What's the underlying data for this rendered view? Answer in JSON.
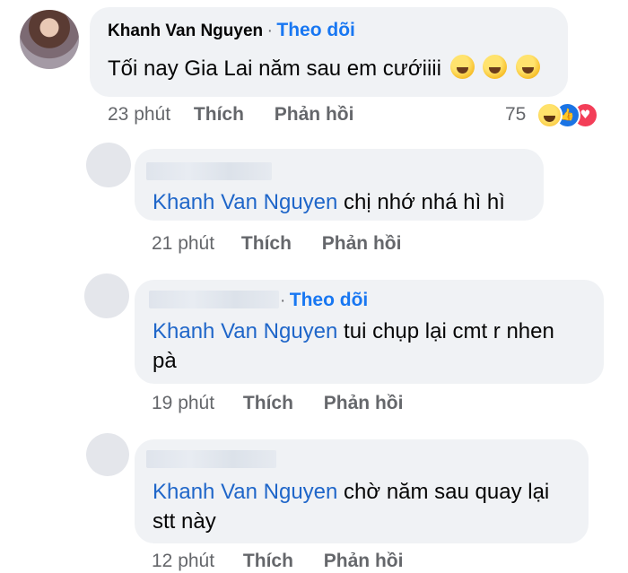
{
  "top_comment": {
    "author": "Khanh Van Nguyen",
    "separator": "·",
    "follow_label": "Theo dõi",
    "text": "Tối nay Gia Lai năm sau em cướiiii",
    "emojis": [
      "rolling-on-floor-laughing",
      "rolling-on-floor-laughing",
      "rolling-on-floor-laughing"
    ],
    "time": "23 phút",
    "like_label": "Thích",
    "reply_label": "Phản hồi",
    "reaction_count": "75",
    "reactions": [
      "haha",
      "like",
      "love"
    ]
  },
  "replies": [
    {
      "author": "",
      "mention": "Khanh Van Nguyen",
      "text": " chị nhớ nhá hì hì",
      "time": "21 phút",
      "like_label": "Thích",
      "reply_label": "Phản hồi"
    },
    {
      "author": "",
      "separator": "·",
      "follow_label": "Theo dõi",
      "mention": "Khanh Van Nguyen",
      "text_line1": " tui chụp lại cmt r nhen",
      "text_line2": "pà",
      "time": "19 phút",
      "like_label": "Thích",
      "reply_label": "Phản hồi"
    },
    {
      "author": "",
      "mention": "Khanh Van Nguyen",
      "text_line1": " chờ năm sau quay lại",
      "text_line2": "stt này",
      "time": "12 phút",
      "like_label": "Thích",
      "reply_label": "Phản hồi"
    }
  ],
  "colors": {
    "bubble": "#f0f2f5",
    "mention": "#1f66c9",
    "follow": "#1877f2",
    "meta": "#65676b"
  }
}
